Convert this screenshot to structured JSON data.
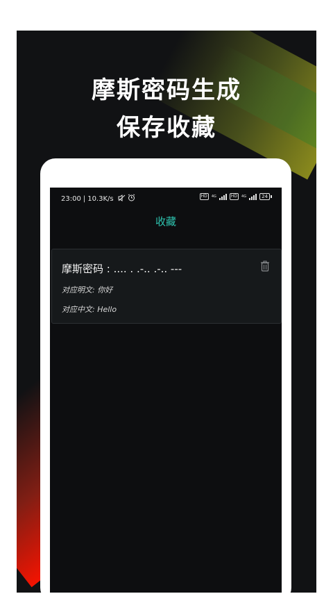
{
  "promo": {
    "headline_line1": "摩斯密码生成",
    "headline_line2": "保存收藏"
  },
  "statusbar": {
    "time": "23:00",
    "separator": "|",
    "speed": "10.3K/s",
    "hd_badge": "HD",
    "network": "4G",
    "battery": "24"
  },
  "appbar": {
    "title": "收藏"
  },
  "favorites": [
    {
      "morse_line": "摩斯密码 : .... . .-.. .-.. ---",
      "plaintext_line": "对应明文: 你好",
      "chinese_line": "对应中文: Hello"
    }
  ],
  "icons": {
    "delete": "trash-icon",
    "alarm": "alarm-clock-icon",
    "mute": "mute-icon"
  },
  "colors": {
    "accent": "#2ec4b0",
    "background": "#0d0e10",
    "card": "#16191b"
  }
}
